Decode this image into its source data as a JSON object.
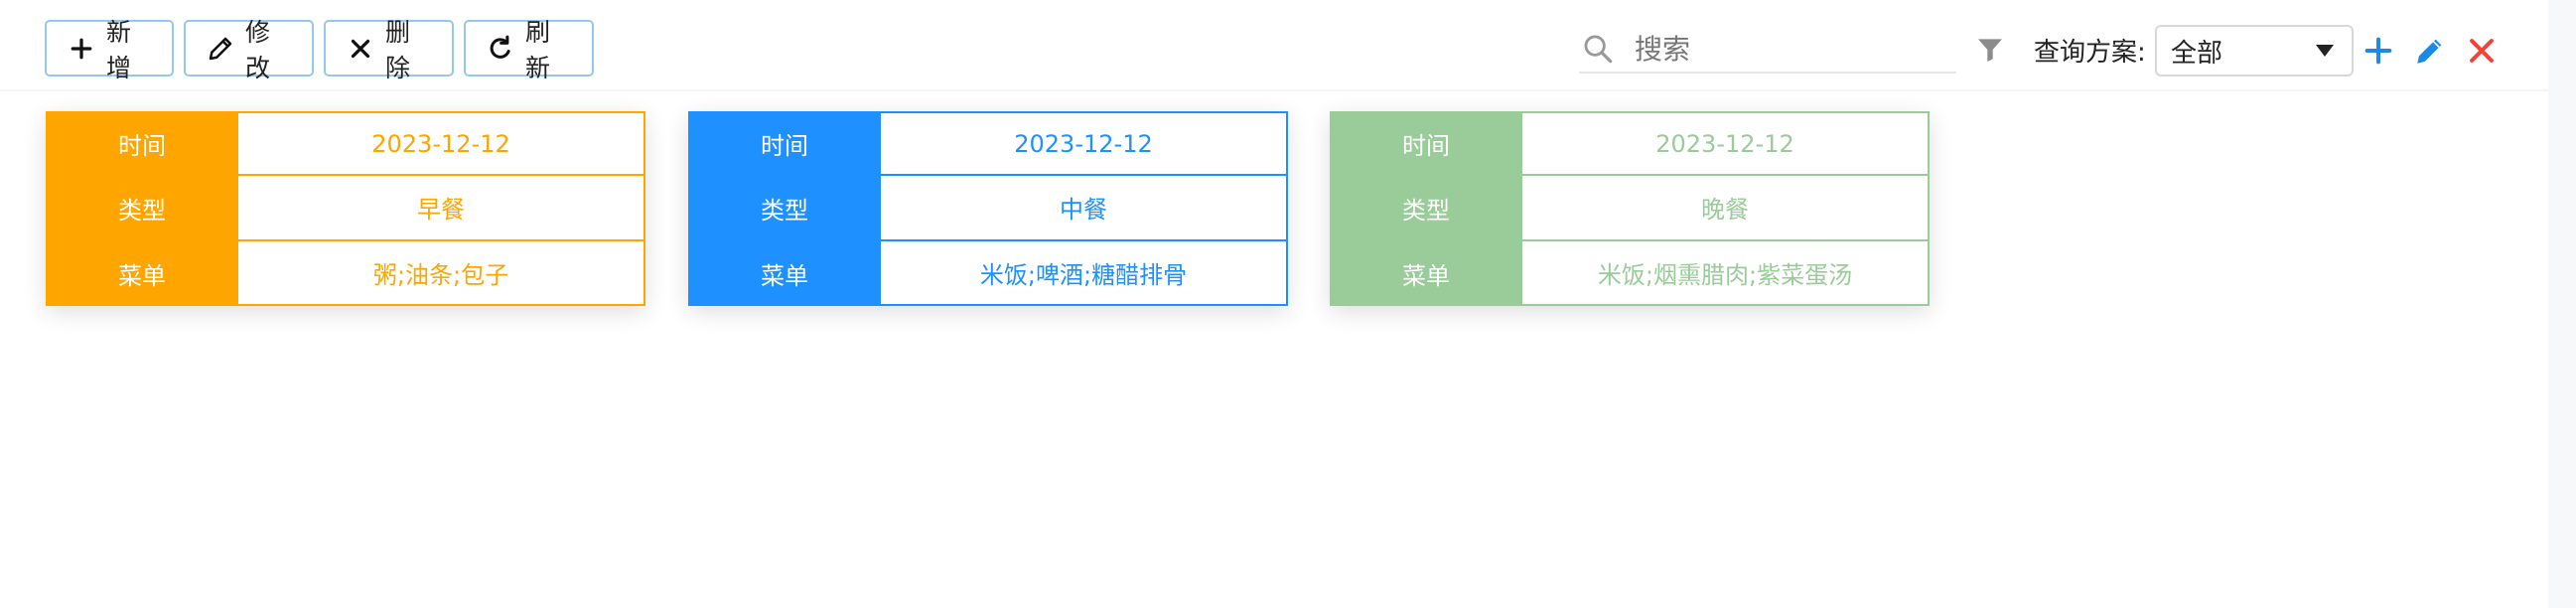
{
  "toolbar": {
    "add_label": "新增",
    "edit_label": "修改",
    "delete_label": "删除",
    "refresh_label": "刷新"
  },
  "search": {
    "placeholder": "搜索"
  },
  "query": {
    "label": "查询方案:",
    "selected": "全部"
  },
  "field_labels": {
    "time": "时间",
    "type": "类型",
    "menu": "菜单"
  },
  "cards": [
    {
      "time": "2023-12-12",
      "type": "早餐",
      "menu": "粥;油条;包子",
      "color": "#ffa500"
    },
    {
      "time": "2023-12-12",
      "type": "中餐",
      "menu": "米饭;啤酒;糖醋排骨",
      "color": "#1e90ff"
    },
    {
      "time": "2023-12-12",
      "type": "晚餐",
      "menu": "米饭;烟熏腊肉;紫菜蛋汤",
      "color": "#99cc99"
    }
  ],
  "colors": {
    "button_border": "#93c8f2",
    "plus_icon": "#1e88e5",
    "edit_icon": "#1e88e5",
    "close_icon": "#f44336"
  },
  "icons": [
    "plus-icon",
    "pencil-icon",
    "close-icon",
    "refresh-icon",
    "search-icon",
    "filter-icon"
  ]
}
